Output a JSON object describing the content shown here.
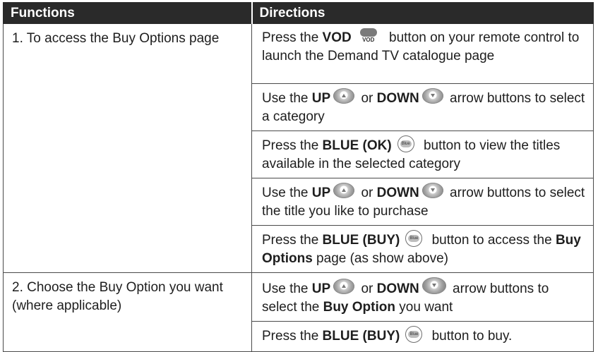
{
  "header": {
    "functions": "Functions",
    "directions": "Directions"
  },
  "rows": [
    {
      "function": "1. To access the Buy Options page",
      "steps": [
        {
          "pre": "Press the ",
          "b1": "VOD",
          "icon": "vod-button-icon",
          "icon_label": "VOD",
          "post": " button on your remote control to launch the Demand TV catalogue page"
        },
        {
          "pre": "Use the ",
          "b1": "UP",
          "mid": " or ",
          "b2": "DOWN",
          "post": " arrow buttons to select a category"
        },
        {
          "pre": "Press the ",
          "b1": "BLUE (OK)",
          "icon_label": "Blue",
          "post": " button to view the titles available in the selected category"
        },
        {
          "pre": "Use the ",
          "b1": "UP",
          "mid": " or ",
          "b2": "DOWN",
          "post": " arrow buttons to select the title you like to purchase"
        },
        {
          "pre": "Press the ",
          "b1": "BLUE (BUY)",
          "icon_label": "Blue",
          "post1": " button to access the ",
          "b2": "Buy Options",
          "post2": " page (as show above)"
        }
      ]
    },
    {
      "function": "2. Choose the Buy Option you want (where applicable)",
      "steps": [
        {
          "pre": "Use the ",
          "b1": "UP",
          "mid": " or ",
          "b2": "DOWN",
          "post1": " arrow buttons to select the ",
          "b3": "Buy Option",
          "post2": " you want"
        },
        {
          "pre": "Press the ",
          "b1": "BLUE (BUY)",
          "icon_label": "Blue",
          "post": " button to buy."
        }
      ]
    }
  ]
}
